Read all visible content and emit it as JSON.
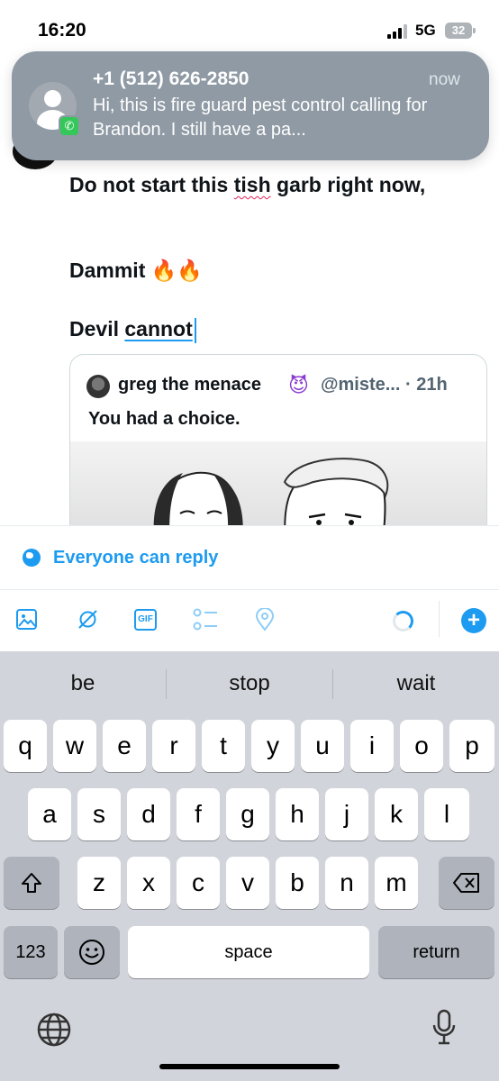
{
  "status_bar": {
    "time": "16:20",
    "network": "5G",
    "battery": "32"
  },
  "composer": {
    "line1_a": "Do not start this ",
    "line1_misspelled": "tish",
    "line1_b": " garb right now,",
    "line2": "Dammit 🔥🔥",
    "line3_a": "Devil ",
    "line3_autocorrected": "cannot"
  },
  "quote": {
    "author_name": "greg the menace",
    "author_emoji": "😈",
    "handle_time": "@miste... · 21h",
    "text": "You had a choice."
  },
  "reply_setting": {
    "label": "Everyone can reply"
  },
  "toolbar": {
    "gif_label": "GIF"
  },
  "keyboard": {
    "suggestions": [
      "be",
      "stop",
      "wait"
    ],
    "row1": [
      "q",
      "w",
      "e",
      "r",
      "t",
      "y",
      "u",
      "i",
      "o",
      "p"
    ],
    "row2": [
      "a",
      "s",
      "d",
      "f",
      "g",
      "h",
      "j",
      "k",
      "l"
    ],
    "row3": [
      "z",
      "x",
      "c",
      "v",
      "b",
      "n",
      "m"
    ],
    "numbers_label": "123",
    "space_label": "space",
    "return_label": "return"
  },
  "notification": {
    "title": "+1 (512) 626-2850",
    "time": "now",
    "body": "Hi, this is fire guard pest control calling for Brandon. I still have a pa..."
  },
  "colors": {
    "accent": "#1d9bf0",
    "keyboard_bg": "#d1d4da",
    "banner_bg": "#8f9aa4"
  }
}
